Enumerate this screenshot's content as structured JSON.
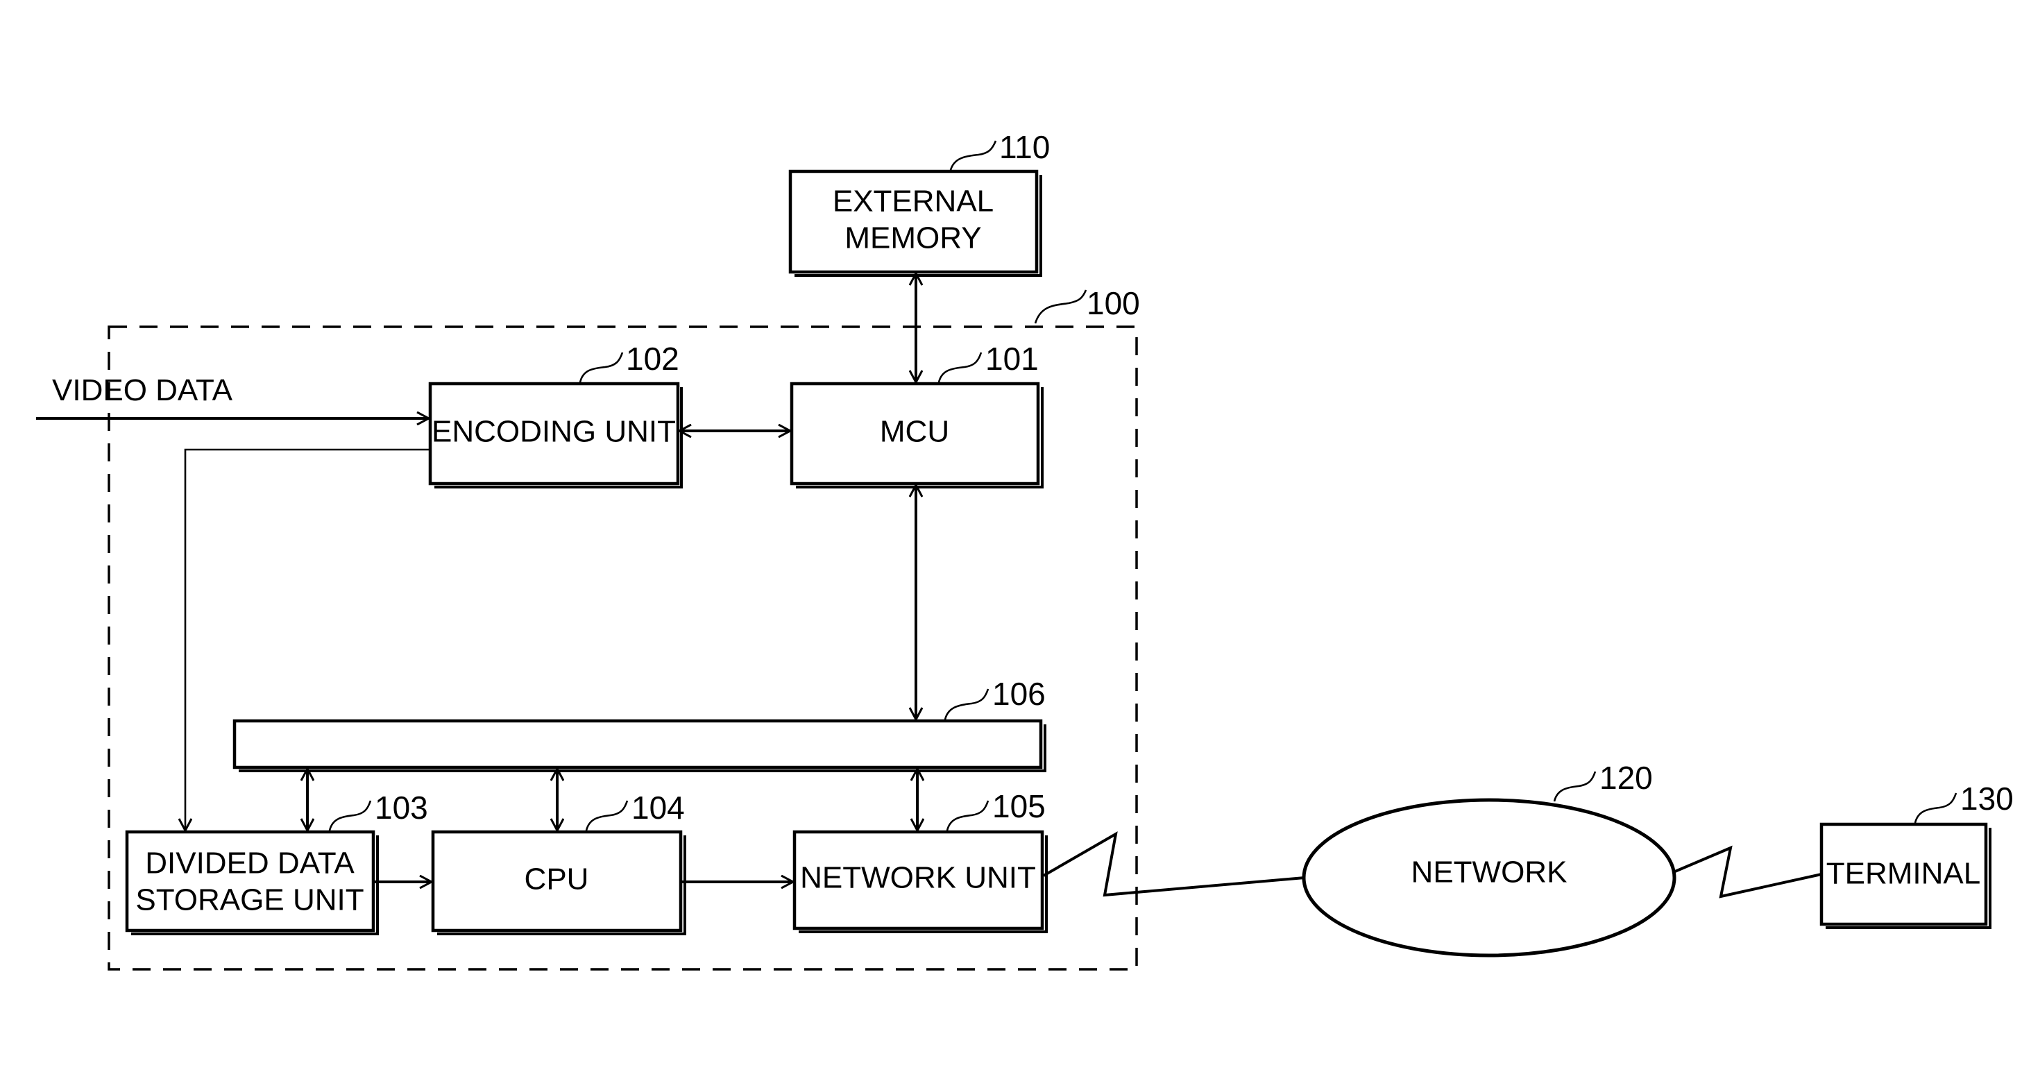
{
  "figure": {
    "type": "block-diagram",
    "input_label": "VIDEO DATA",
    "system_boundary": {
      "ref": "100"
    },
    "blocks": {
      "external_memory": {
        "ref": "110",
        "lines": [
          "EXTERNAL",
          "MEMORY"
        ]
      },
      "mcu": {
        "ref": "101",
        "label": "MCU"
      },
      "encoding_unit": {
        "ref": "102",
        "label": "ENCODING UNIT"
      },
      "divided_data_storage": {
        "ref": "103",
        "lines": [
          "DIVIDED DATA",
          "STORAGE UNIT"
        ]
      },
      "cpu": {
        "ref": "104",
        "label": "CPU"
      },
      "network_unit": {
        "ref": "105",
        "label": "NETWORK UNIT"
      },
      "bus": {
        "ref": "106",
        "label": ""
      },
      "network": {
        "ref": "120",
        "label": "NETWORK"
      },
      "terminal": {
        "ref": "130",
        "label": "TERMINAL"
      }
    },
    "connections": [
      {
        "from": "VIDEO DATA",
        "to": "ENCODING UNIT",
        "direction": "one-way"
      },
      {
        "from": "ENCODING UNIT",
        "to": "MCU",
        "direction": "bidirectional"
      },
      {
        "from": "EXTERNAL MEMORY",
        "to": "MCU",
        "direction": "bidirectional"
      },
      {
        "from": "MCU",
        "to": "106",
        "direction": "bidirectional"
      },
      {
        "from": "ENCODING UNIT",
        "to": "DIVIDED DATA STORAGE UNIT",
        "direction": "one-way"
      },
      {
        "from": "106",
        "to": "DIVIDED DATA STORAGE UNIT",
        "direction": "bidirectional"
      },
      {
        "from": "106",
        "to": "CPU",
        "direction": "bidirectional"
      },
      {
        "from": "106",
        "to": "NETWORK UNIT",
        "direction": "bidirectional"
      },
      {
        "from": "DIVIDED DATA STORAGE UNIT",
        "to": "CPU",
        "direction": "one-way"
      },
      {
        "from": "CPU",
        "to": "NETWORK UNIT",
        "direction": "one-way"
      },
      {
        "from": "NETWORK UNIT",
        "to": "NETWORK",
        "direction": "wireless-link"
      },
      {
        "from": "NETWORK",
        "to": "TERMINAL",
        "direction": "wireless-link"
      }
    ]
  }
}
